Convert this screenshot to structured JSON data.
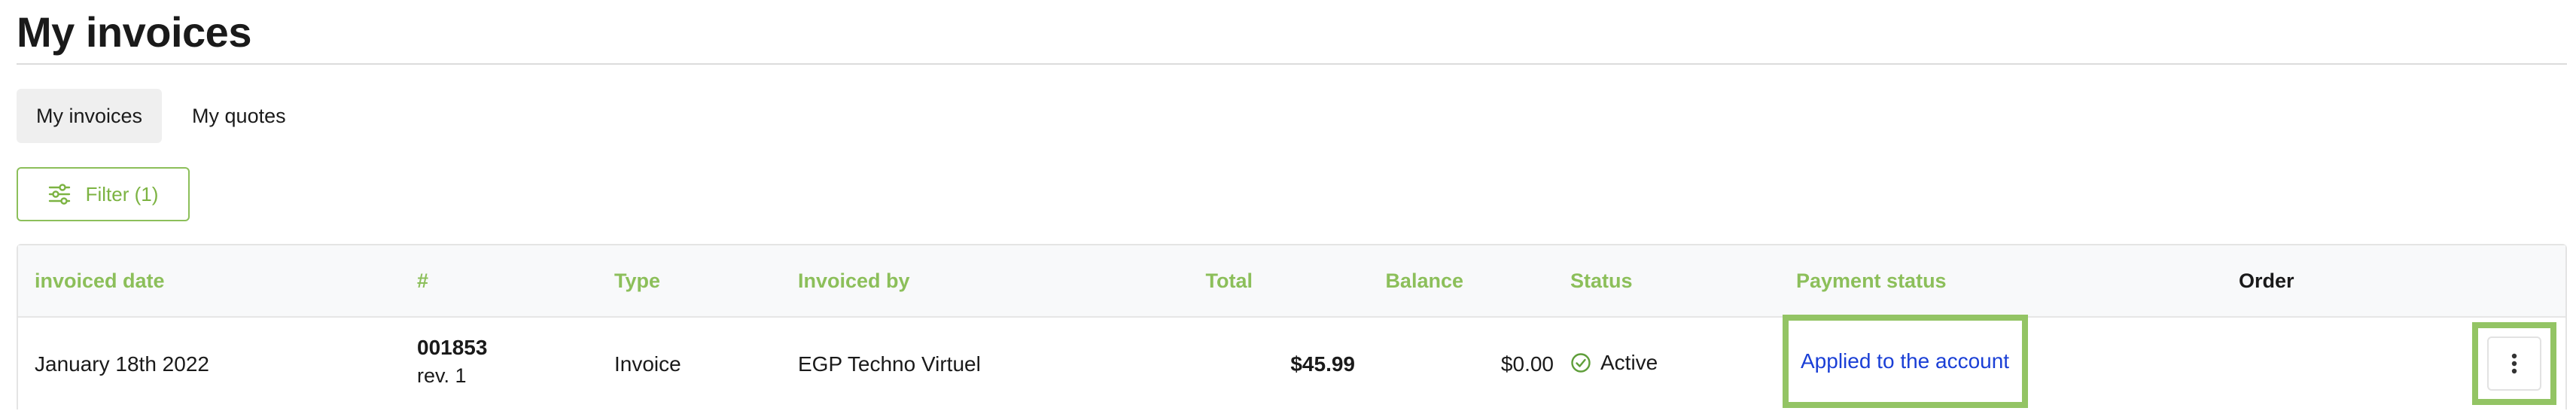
{
  "page": {
    "title": "My invoices"
  },
  "tabs": [
    {
      "label": "My invoices",
      "active": true
    },
    {
      "label": "My quotes",
      "active": false
    }
  ],
  "filter": {
    "label": "Filter (1)",
    "icon": "sliders-icon"
  },
  "table": {
    "columns": [
      "invoiced date",
      "#",
      "Type",
      "Invoiced by",
      "Total",
      "Balance",
      "Status",
      "Payment status",
      "Order"
    ],
    "rows": [
      {
        "invoiced_date": "January 18th 2022",
        "number": "001853",
        "revision": "rev. 1",
        "type": "Invoice",
        "invoiced_by": "EGP Techno Virtuel",
        "total": "$45.99",
        "balance": "$0.00",
        "status": "Active",
        "status_icon": "check-circle-icon",
        "payment_status": "Applied to the account",
        "actions_icon": "kebab-menu-icon"
      }
    ]
  },
  "colors": {
    "accent_green": "#8cbf5a",
    "highlight_green": "#93c464",
    "link_blue": "#1a3fd6",
    "header_bg": "#f8f9fa"
  }
}
